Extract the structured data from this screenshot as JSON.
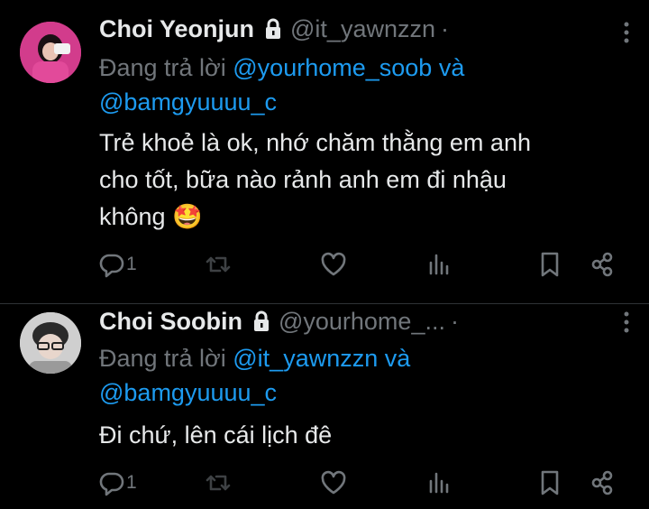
{
  "colors": {
    "bg": "#000000",
    "text": "#e7e9ea",
    "muted": "#71767b",
    "link": "#1d9bf0",
    "divider": "#2f3336"
  },
  "tweets": [
    {
      "name": "Choi Yeonjun",
      "handle": "@it_yawnzzn",
      "dot": "·",
      "reply_prefix": "Đang trả lời ",
      "mention_a": "@yourhome_soob",
      "reply_join": " và",
      "mention_b": "@bamgyuuuu_c",
      "text_line1": "Trẻ khoẻ là ok, nhớ chăm thằng em anh",
      "text_line2": "cho tốt, bữa nào rảnh anh em đi nhậu",
      "text_line3": "không",
      "emoji": "🤩",
      "reply_count": "1",
      "icons": [
        "lock-icon",
        "more-icon",
        "reply-icon",
        "retweet-icon",
        "like-icon",
        "views-icon",
        "bookmark-icon",
        "share-icon"
      ]
    },
    {
      "name": "Choi Soobin",
      "handle": "@yourhome_...",
      "dot": "·",
      "reply_prefix": "Đang trả lời ",
      "mention_a": "@it_yawnzzn",
      "reply_join": " và",
      "mention_b": "@bamgyuuuu_c",
      "text_line1": "Đi chứ, lên cái lịch đê",
      "reply_count": "1",
      "icons": [
        "lock-icon",
        "more-icon",
        "reply-icon",
        "retweet-icon",
        "like-icon",
        "views-icon",
        "bookmark-icon",
        "share-icon"
      ]
    }
  ]
}
